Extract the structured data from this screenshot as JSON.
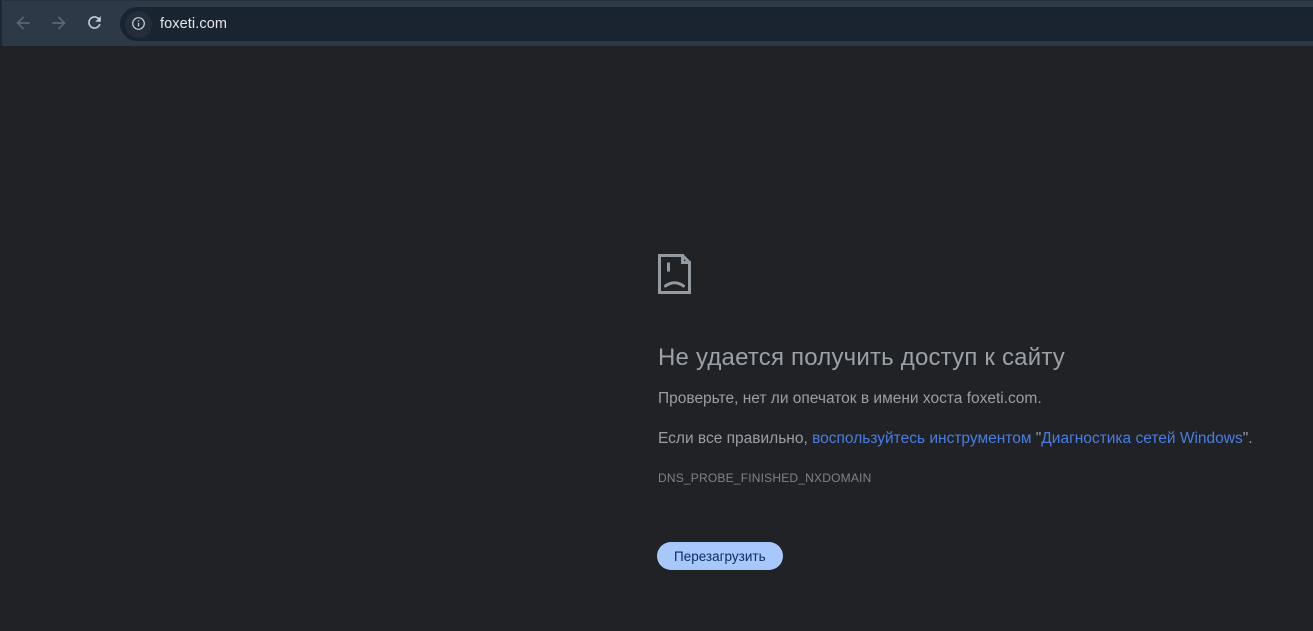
{
  "browser": {
    "toolbar": {
      "back_icon": "arrow-left",
      "forward_icon": "arrow-right",
      "reload_icon": "reload"
    },
    "omnibox": {
      "site_info_icon": "info-circle",
      "url": "foxeti.com"
    }
  },
  "error_page": {
    "sad_file_icon": "sad-file",
    "title": "Не удается получить доступ к сайту",
    "check_typo_line": "Проверьте, нет ли опечаток в имени хоста foxeti.com.",
    "diagnostics_line": {
      "prefix": "Если все правильно, ",
      "link_part_1": "воспользуйтесь инструментом",
      "middle": " \"",
      "link_part_2": "Диагностика сетей Windows",
      "suffix": "\"."
    },
    "error_code": "DNS_PROBE_FINISHED_NXDOMAIN",
    "reload_button_label": "Перезагрузить"
  },
  "colors": {
    "toolbar_bg": "#2e3947",
    "omnibox_bg": "#1a2330",
    "page_bg": "#212226",
    "link": "#4a7de0",
    "button_bg": "#a8c7fa",
    "button_text": "#0b2e64",
    "title_text": "#9aa1a8",
    "body_text": "#999fa6",
    "error_code_text": "#7d8389",
    "url_text": "#e4e7eb",
    "icon_dim": "#5c6776",
    "icon_bright": "#c5cbd3"
  }
}
